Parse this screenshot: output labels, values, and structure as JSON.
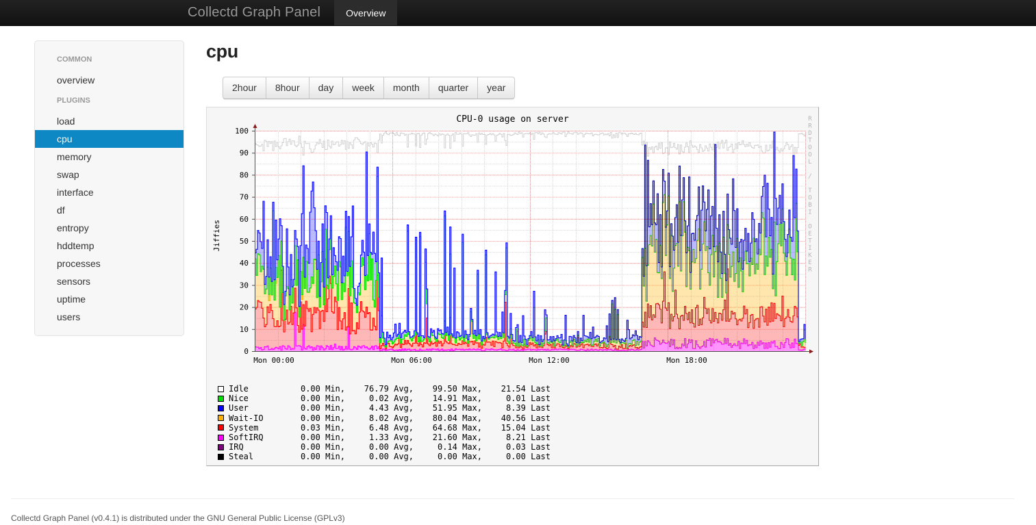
{
  "navbar": {
    "brand": "Collectd Graph Panel",
    "tabs": [
      {
        "label": "Overview",
        "active": true
      }
    ]
  },
  "sidebar": {
    "groups": [
      {
        "header": "COMMON",
        "items": [
          {
            "label": "overview",
            "active": false
          }
        ]
      },
      {
        "header": "PLUGINS",
        "items": [
          {
            "label": "load",
            "active": false
          },
          {
            "label": "cpu",
            "active": true
          },
          {
            "label": "memory",
            "active": false
          },
          {
            "label": "swap",
            "active": false
          },
          {
            "label": "interface",
            "active": false
          },
          {
            "label": "df",
            "active": false
          },
          {
            "label": "entropy",
            "active": false
          },
          {
            "label": "hddtemp",
            "active": false
          },
          {
            "label": "processes",
            "active": false
          },
          {
            "label": "sensors",
            "active": false
          },
          {
            "label": "uptime",
            "active": false
          },
          {
            "label": "users",
            "active": false
          }
        ]
      }
    ]
  },
  "main": {
    "page_title": "cpu",
    "timespans": [
      {
        "label": "2hour",
        "active": false
      },
      {
        "label": "8hour",
        "active": false
      },
      {
        "label": "day",
        "active": false
      },
      {
        "label": "week",
        "active": false
      },
      {
        "label": "month",
        "active": false
      },
      {
        "label": "quarter",
        "active": false
      },
      {
        "label": "year",
        "active": false
      }
    ],
    "graph": {
      "watermark": "RRDTOOL / TOBI OETIKER"
    }
  },
  "footer": {
    "text": "Collectd Graph Panel (v0.4.1) is distributed under the GNU General Public License (GPLv3)"
  },
  "colors": {
    "accent": "#0088cc",
    "active_nav": "#0e88c4",
    "navbar_bg": "#1b1b1b",
    "idle": "#ffffff",
    "nice": "#00e000",
    "user": "#0000ff",
    "waitio": "#ffb000",
    "system": "#ff0000",
    "softirq": "#ff00ff",
    "irq": "#800080",
    "steal": "#000000"
  },
  "chart_data": {
    "type": "area",
    "title": "CPU-0 usage on server",
    "xlabel": "",
    "ylabel": "Jiffies",
    "ylim": [
      0,
      100
    ],
    "yticks": [
      0,
      10,
      20,
      30,
      40,
      50,
      60,
      70,
      80,
      90,
      100
    ],
    "xticks": [
      "Mon 00:00",
      "Mon 06:00",
      "Mon 12:00",
      "Mon 18:00"
    ],
    "grid": true,
    "stacked": true,
    "legend_position": "below",
    "legend_columns": [
      "Min",
      "Avg",
      "Max",
      "Last"
    ],
    "series": [
      {
        "name": "Idle",
        "color": "#ffffff",
        "min": "0.00",
        "avg": "76.79",
        "max": "99.50",
        "last": "21.54"
      },
      {
        "name": "Nice",
        "color": "#00e000",
        "min": "0.00",
        "avg": "0.02",
        "max": "14.91",
        "last": "0.01"
      },
      {
        "name": "User",
        "color": "#0000ff",
        "min": "0.00",
        "avg": "4.43",
        "max": "51.95",
        "last": "8.39"
      },
      {
        "name": "Wait-IO",
        "color": "#ffb000",
        "min": "0.00",
        "avg": "8.02",
        "max": "80.04",
        "last": "40.56"
      },
      {
        "name": "System",
        "color": "#ff0000",
        "min": "0.03",
        "avg": "6.48",
        "max": "64.68",
        "last": "15.04"
      },
      {
        "name": "SoftIRQ",
        "color": "#ff00ff",
        "min": "0.00",
        "avg": "1.33",
        "max": "21.60",
        "last": "8.21"
      },
      {
        "name": "IRQ",
        "color": "#800080",
        "min": "0.00",
        "avg": "0.00",
        "max": "0.14",
        "last": "0.03"
      },
      {
        "name": "Steal",
        "color": "#000000",
        "min": "0.00",
        "avg": "0.00",
        "max": "0.00",
        "last": "0.00"
      }
    ]
  }
}
